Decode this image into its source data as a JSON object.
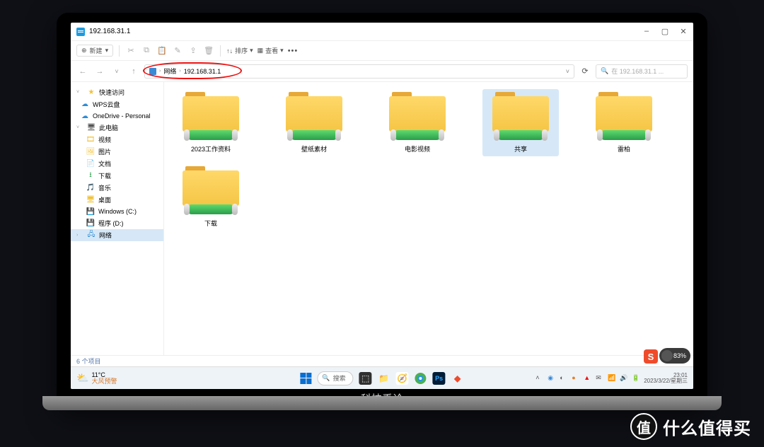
{
  "window": {
    "title": "192.168.31.1"
  },
  "toolbar": {
    "new": "新建",
    "sort": "排序",
    "view": "查看"
  },
  "breadcrumb": {
    "level1": "网络",
    "level2": "192.168.31.1"
  },
  "search": {
    "placeholder": "在 192.168.31.1 ..."
  },
  "sidebar": {
    "quick": "快速访问",
    "wps": "WPS云盘",
    "onedrive": "OneDrive - Personal",
    "thispc": "此电脑",
    "videos": "视频",
    "pictures": "图片",
    "documents": "文档",
    "downloads": "下载",
    "music": "音乐",
    "desktop": "桌面",
    "cdrive": "Windows (C:)",
    "programs": "程序 (D:)",
    "network": "网络"
  },
  "folders": [
    {
      "label": "2023工作资料"
    },
    {
      "label": "壁纸素材"
    },
    {
      "label": "电影视频"
    },
    {
      "label": "共享"
    },
    {
      "label": "雷柏"
    },
    {
      "label": "下载"
    }
  ],
  "status": {
    "count": "6 个项目"
  },
  "battery": {
    "pct": "83%"
  },
  "taskbar": {
    "weather_temp": "11°C",
    "weather_desc": "大风预警",
    "search_label": "搜索",
    "time": "23:01",
    "date": "2023/3/22/星期三"
  },
  "laptop_caption": "科技禹论",
  "watermark": {
    "icon": "值",
    "text": "什么值得买"
  }
}
